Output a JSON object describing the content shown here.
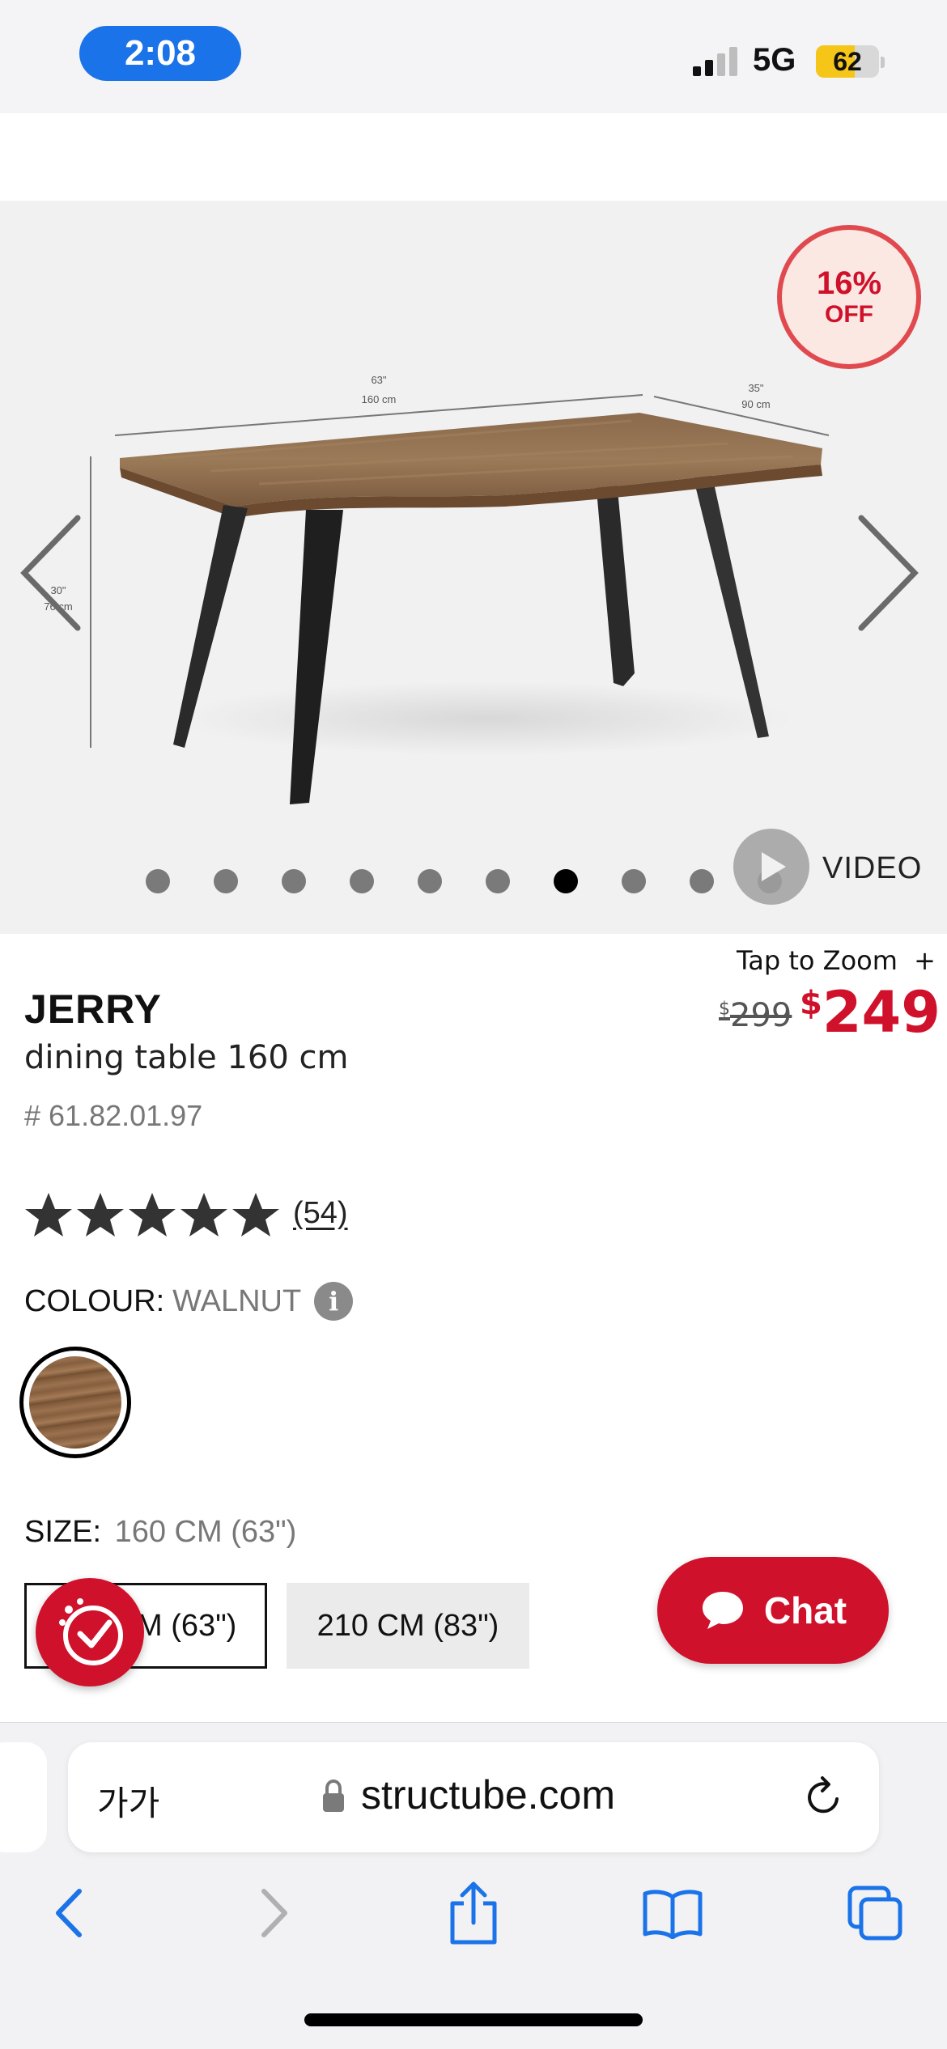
{
  "status_bar": {
    "time": "2:08",
    "network": "5G",
    "battery": "62",
    "battery_level": 0.62,
    "accent_color": "#1a73e8"
  },
  "gallery": {
    "discount_percent": "16%",
    "discount_off": "OFF",
    "dimension_width": "63\"",
    "dimension_width_cm": "160 cm",
    "dimension_depth": "35\"",
    "dimension_depth_cm": "90 cm",
    "dimension_height": "30\"",
    "dimension_height_cm": "76 cm",
    "dot_count": 10,
    "active_dot": 7,
    "video_label": "VIDEO",
    "prev_icon": "chevron-left-icon",
    "next_icon": "chevron-right-icon"
  },
  "product": {
    "tap_to_zoom": "Tap to Zoom",
    "zoom_plus": "+",
    "name": "JERRY",
    "description": "dining table 160 cm",
    "sku": "# 61.82.01.97",
    "currency": "$",
    "old_price": "299",
    "new_price": "249",
    "rating": 5,
    "reviews": "(54)",
    "colour_label": "COLOUR:",
    "colour_value": "WALNUT",
    "info_glyph": "i",
    "size_label": "SIZE:",
    "size_value": "160 CM (63\")",
    "sizes": [
      {
        "label": "160 CM (63\")",
        "selected": true
      },
      {
        "label": "210 CM (83\")",
        "selected": false
      }
    ],
    "price_color": "#d0112b"
  },
  "chat": {
    "label": "Chat",
    "icon": "chat-bubble-icon"
  },
  "browser": {
    "aa_label": "가가",
    "url": "structube.com",
    "icons": [
      "back-icon",
      "forward-icon",
      "share-icon",
      "bookmarks-icon",
      "tabs-icon"
    ]
  }
}
